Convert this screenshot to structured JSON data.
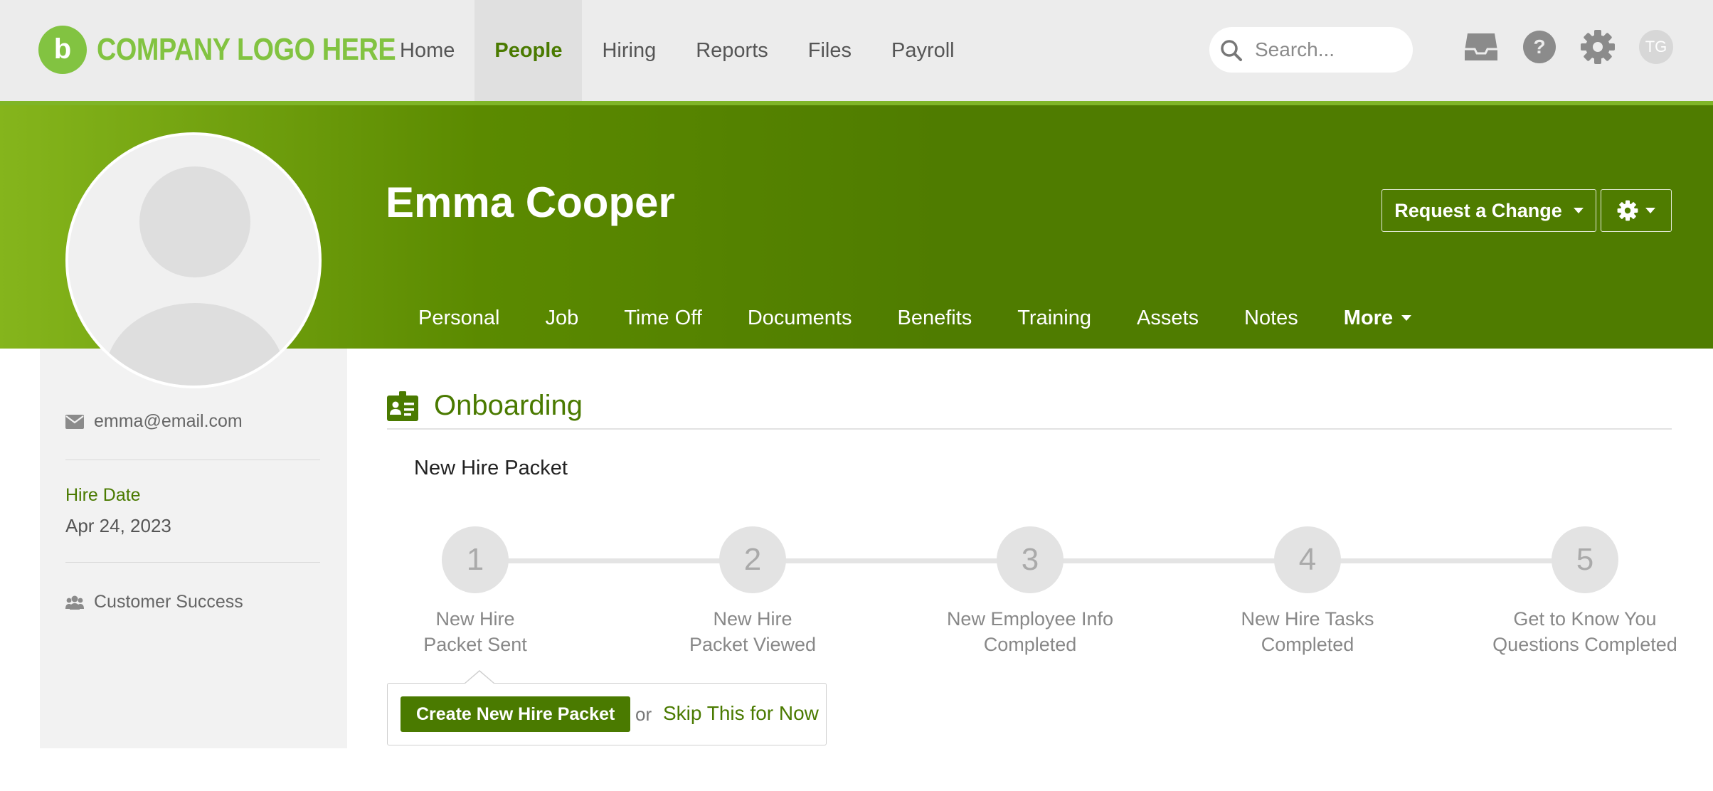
{
  "header": {
    "logo_mark": "b",
    "logo_text": "COMPANY LOGO HERE",
    "nav": [
      {
        "label": "Home"
      },
      {
        "label": "People",
        "active": true
      },
      {
        "label": "Hiring"
      },
      {
        "label": "Reports"
      },
      {
        "label": "Files"
      },
      {
        "label": "Payroll"
      }
    ],
    "search_placeholder": "Search...",
    "user_initials": "TG",
    "icons": [
      "inbox-icon",
      "help-icon",
      "settings-icon"
    ]
  },
  "profile": {
    "name": "Emma Cooper",
    "request_change_label": "Request a Change",
    "tabs": [
      "Personal",
      "Job",
      "Time Off",
      "Documents",
      "Benefits",
      "Training",
      "Assets",
      "Notes",
      "More"
    ]
  },
  "sidebar": {
    "email": "emma@email.com",
    "hire_date_label": "Hire Date",
    "hire_date": "Apr 24, 2023",
    "department": "Customer Success"
  },
  "onboarding": {
    "title": "Onboarding",
    "packet_title": "New Hire Packet",
    "steps": [
      {
        "number": "1",
        "line1": "New Hire",
        "line2": "Packet Sent"
      },
      {
        "number": "2",
        "line1": "New Hire",
        "line2": "Packet Viewed"
      },
      {
        "number": "3",
        "line1": "New Employee Info",
        "line2": "Completed"
      },
      {
        "number": "4",
        "line1": "New Hire Tasks",
        "line2": "Completed"
      },
      {
        "number": "5",
        "line1": "Get to Know You",
        "line2": "Questions Completed"
      }
    ],
    "create_button": "Create New Hire Packet",
    "or_text": "or",
    "skip_link": "Skip This for Now"
  },
  "colors": {
    "brand_green": "#4a7a00",
    "logo_green": "#82c341",
    "banner_light": "#85b51c"
  }
}
